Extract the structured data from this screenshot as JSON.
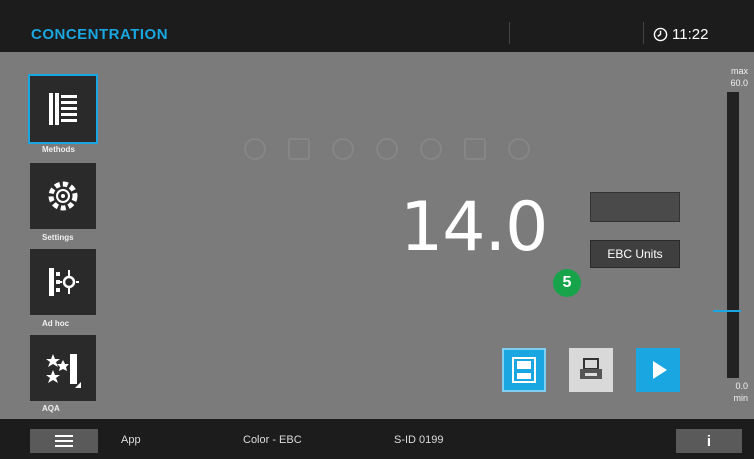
{
  "header": {
    "title": "CONCENTRATION",
    "time": "11:22"
  },
  "sidebar": {
    "items": [
      {
        "label": "Methods",
        "icon": "methods-icon",
        "active": true
      },
      {
        "label": "Settings",
        "icon": "gear-icon",
        "active": false
      },
      {
        "label": "Ad hoc",
        "icon": "adhoc-icon",
        "active": false
      },
      {
        "label": "AQA",
        "icon": "aqa-stars-icon",
        "active": false
      }
    ]
  },
  "measurement": {
    "value": "14.0",
    "unit": "EBC Units",
    "badge": "5"
  },
  "scale": {
    "max_label": "max",
    "max_value": "60.0",
    "min_value": "0.0",
    "min_label": "min",
    "level": 0.233
  },
  "footer": {
    "app": "App",
    "method": "Color - EBC",
    "sid": "S-ID 0199",
    "info": "i"
  },
  "colors": {
    "accent": "#1aa6e0",
    "badge": "#17a34a",
    "header_bg": "#1c1c1c",
    "panel_bg": "#7b7b7b"
  }
}
